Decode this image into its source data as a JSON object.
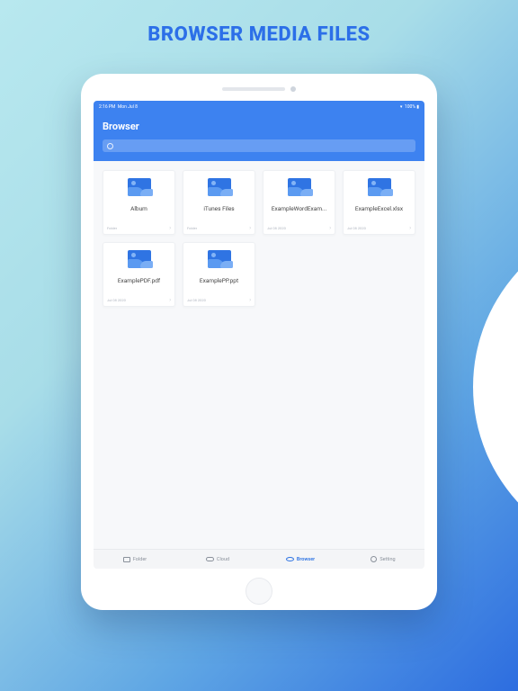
{
  "marketing_title": "BROWSER MEDIA FILES",
  "statusbar": {
    "time": "2:16 PM",
    "date": "Mon Jul 8",
    "battery": "100%"
  },
  "header": {
    "title": "Browser"
  },
  "files": [
    {
      "name": "Album",
      "meta": "Folder"
    },
    {
      "name": "iTunes Files",
      "meta": "Folder"
    },
    {
      "name": "ExampleWordExam...",
      "meta": "Jul 08 2020"
    },
    {
      "name": "ExampleExcel.xlsx",
      "meta": "Jul 08 2020"
    },
    {
      "name": "ExamplePDF.pdf",
      "meta": "Jul 08 2020"
    },
    {
      "name": "ExamplePP.ppt",
      "meta": "Jul 08 2020"
    }
  ],
  "tabs": [
    {
      "label": "Folder",
      "active": false
    },
    {
      "label": "Cloud",
      "active": false
    },
    {
      "label": "Browser",
      "active": true
    },
    {
      "label": "Setting",
      "active": false
    }
  ]
}
